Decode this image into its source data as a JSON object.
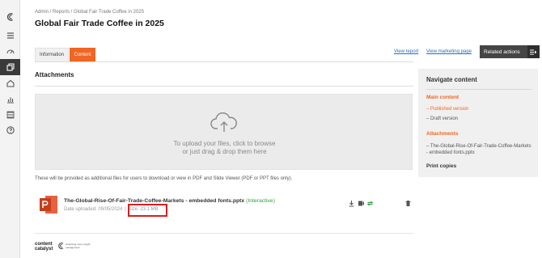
{
  "breadcrumb": "Admin / Reports / Global Fair Trade Coffee in 2025",
  "page_title": "Global Fair Trade Coffee in 2025",
  "tabs": [
    {
      "label": "Information"
    },
    {
      "label": "Content"
    }
  ],
  "links": {
    "view_report": "View report",
    "view_marketing": "View marketing page"
  },
  "related_actions": "Related actions",
  "attachments": {
    "heading": "Attachments",
    "upload_line1": "To upload your files, click to browse",
    "upload_line2": "or just drag & drop them here",
    "note": "These will be provided as additional files for users to download or view in PDF and Slide Viewer (PDF or PPT files only)."
  },
  "file": {
    "name": "The-Global-Rise-Of-Fair-Trade-Coffee-Markets - embedded fonts.pptx",
    "interactive": "(Interactive)",
    "date_uploaded": "Date uploaded: 09/05/2024",
    "separator": "|",
    "size": "Size: 23.1 MB",
    "icon": "powerpoint-file-icon"
  },
  "navigate": {
    "title": "Navigate content",
    "main_section": "Main content",
    "published": "– Published version",
    "draft": "– Draft version",
    "attachments_section": "Attachments",
    "attachment_item": "– The-Global-Rise-Of-Fair-Trade-Coffee-Markets - embedded fonts.pptx",
    "print": "Print copies"
  },
  "footer_logo": {
    "line1": "content",
    "line2": "catalyst",
    "tagline": "Unlocking more insight management"
  },
  "colors": {
    "accent": "#f26522",
    "link": "#2a6ebb",
    "interactive": "#2e9e3e",
    "highlight": "#d81f1f",
    "sidebar_active": "#3a3a3a"
  }
}
